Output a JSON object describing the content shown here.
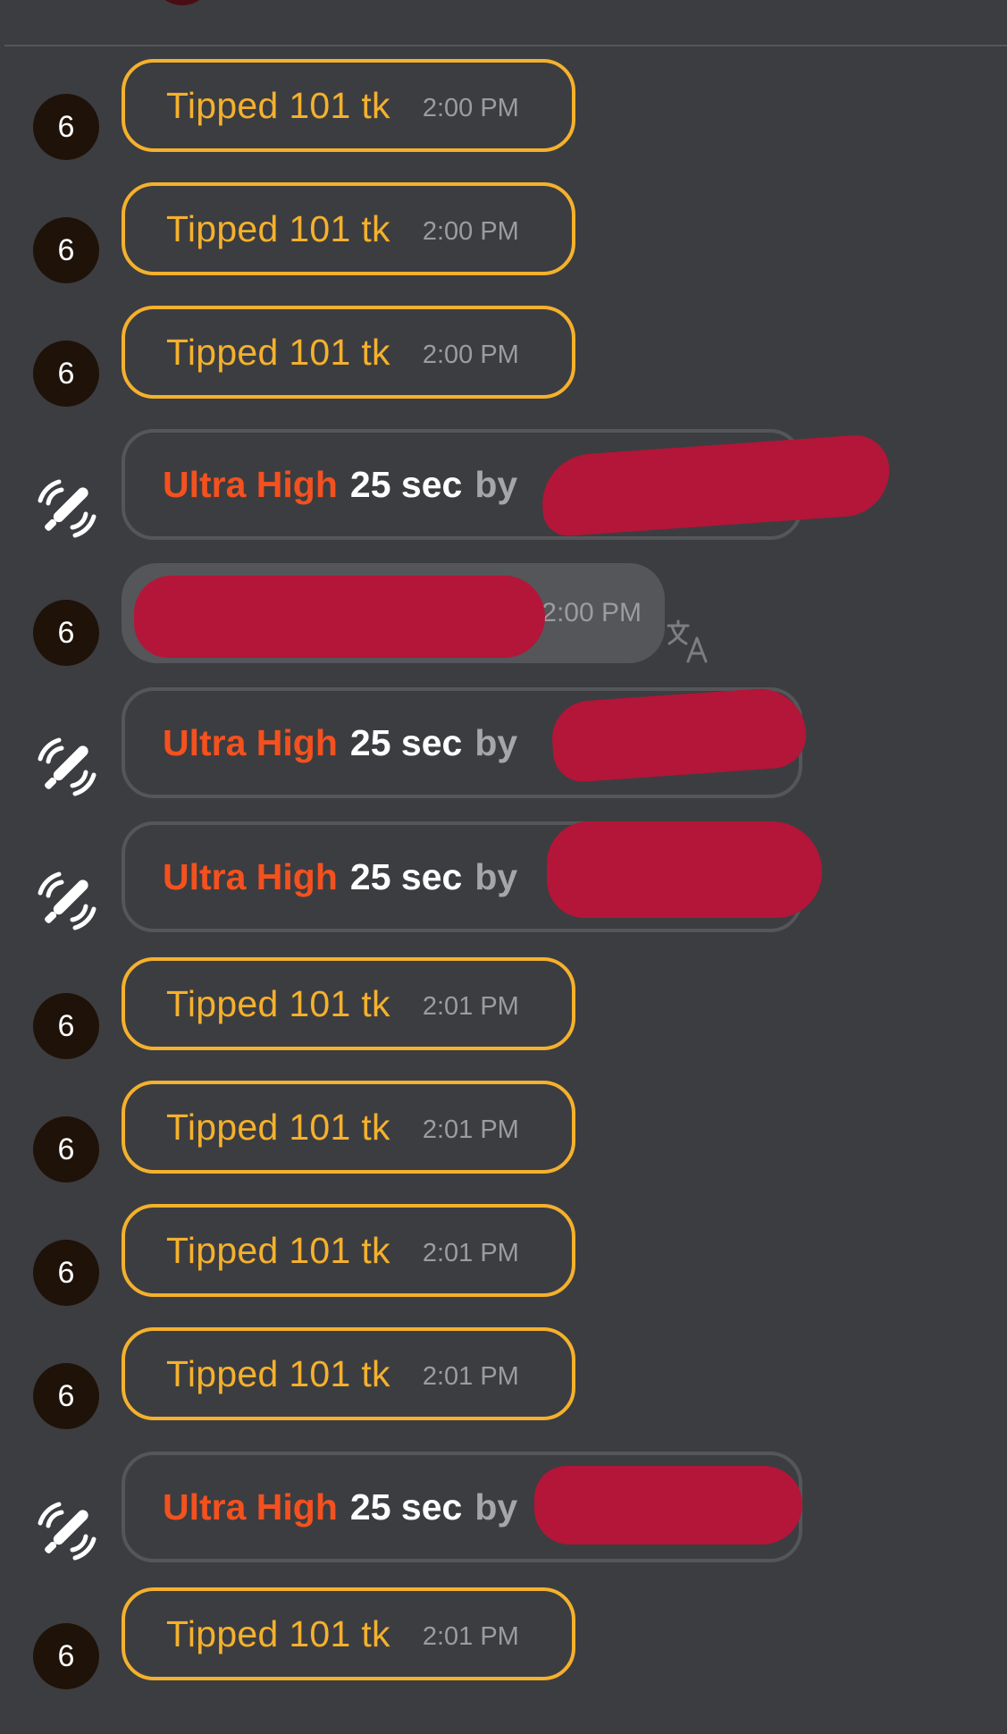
{
  "colors": {
    "background": "#3c3d41",
    "tip_accent": "#f5b12c",
    "ultra_accent": "#f4511e",
    "timestamp": "#9b9ca0",
    "avatar_bg": "#1f1208",
    "redaction": "#b31638"
  },
  "feed": {
    "rows": [
      {
        "type": "tip",
        "avatar": "6",
        "text": "Tipped 101 tk",
        "time": "2:00 PM"
      },
      {
        "type": "tip",
        "avatar": "6",
        "text": "Tipped 101 tk",
        "time": "2:00 PM"
      },
      {
        "type": "tip",
        "avatar": "6",
        "text": "Tipped 101 tk",
        "time": "2:00 PM"
      },
      {
        "type": "ultra",
        "icon": "vibrator-icon",
        "level": "Ultra High",
        "duration": "25 sec",
        "by": "by"
      },
      {
        "type": "chat",
        "avatar": "6",
        "time": "2:00 PM",
        "translate_icon": "translate-icon"
      },
      {
        "type": "ultra",
        "icon": "vibrator-icon",
        "level": "Ultra High",
        "duration": "25 sec",
        "by": "by"
      },
      {
        "type": "ultra",
        "icon": "vibrator-icon",
        "level": "Ultra High",
        "duration": "25 sec",
        "by": "by"
      },
      {
        "type": "tip",
        "avatar": "6",
        "text": "Tipped 101 tk",
        "time": "2:01 PM"
      },
      {
        "type": "tip",
        "avatar": "6",
        "text": "Tipped 101 tk",
        "time": "2:01 PM"
      },
      {
        "type": "tip",
        "avatar": "6",
        "text": "Tipped 101 tk",
        "time": "2:01 PM"
      },
      {
        "type": "tip",
        "avatar": "6",
        "text": "Tipped 101 tk",
        "time": "2:01 PM"
      },
      {
        "type": "ultra",
        "icon": "vibrator-icon",
        "level": "Ultra High",
        "duration": "25 sec",
        "by": "by"
      },
      {
        "type": "tip",
        "avatar": "6",
        "text": "Tipped 101 tk",
        "time": "2:01 PM"
      }
    ]
  }
}
